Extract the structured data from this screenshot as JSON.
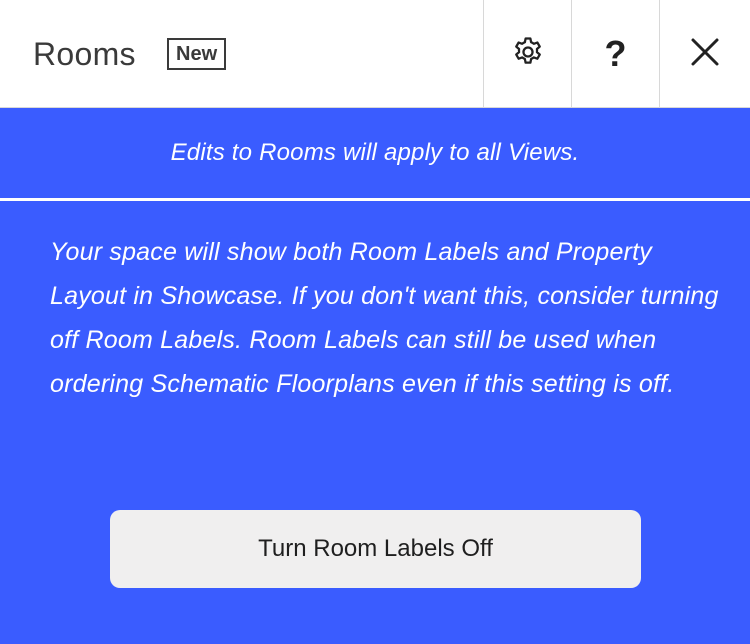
{
  "header": {
    "title": "Rooms",
    "badge": "New",
    "buttons": {
      "settings_icon": "gear-icon",
      "help_label": "?",
      "close_icon": "close-icon"
    }
  },
  "notice": {
    "text": "Edits to Rooms will apply to all Views."
  },
  "body": {
    "message": "Your space will show both Room Labels and Property Layout in Showcase. If you don't want this, consider turning off Room Labels. Room Labels can still be used when ordering Schematic Floorplans even if this setting is off."
  },
  "action": {
    "label": "Turn Room Labels Off"
  },
  "colors": {
    "accent": "#3a5cff",
    "header_bg": "#ffffff",
    "button_bg": "#f0efef"
  }
}
